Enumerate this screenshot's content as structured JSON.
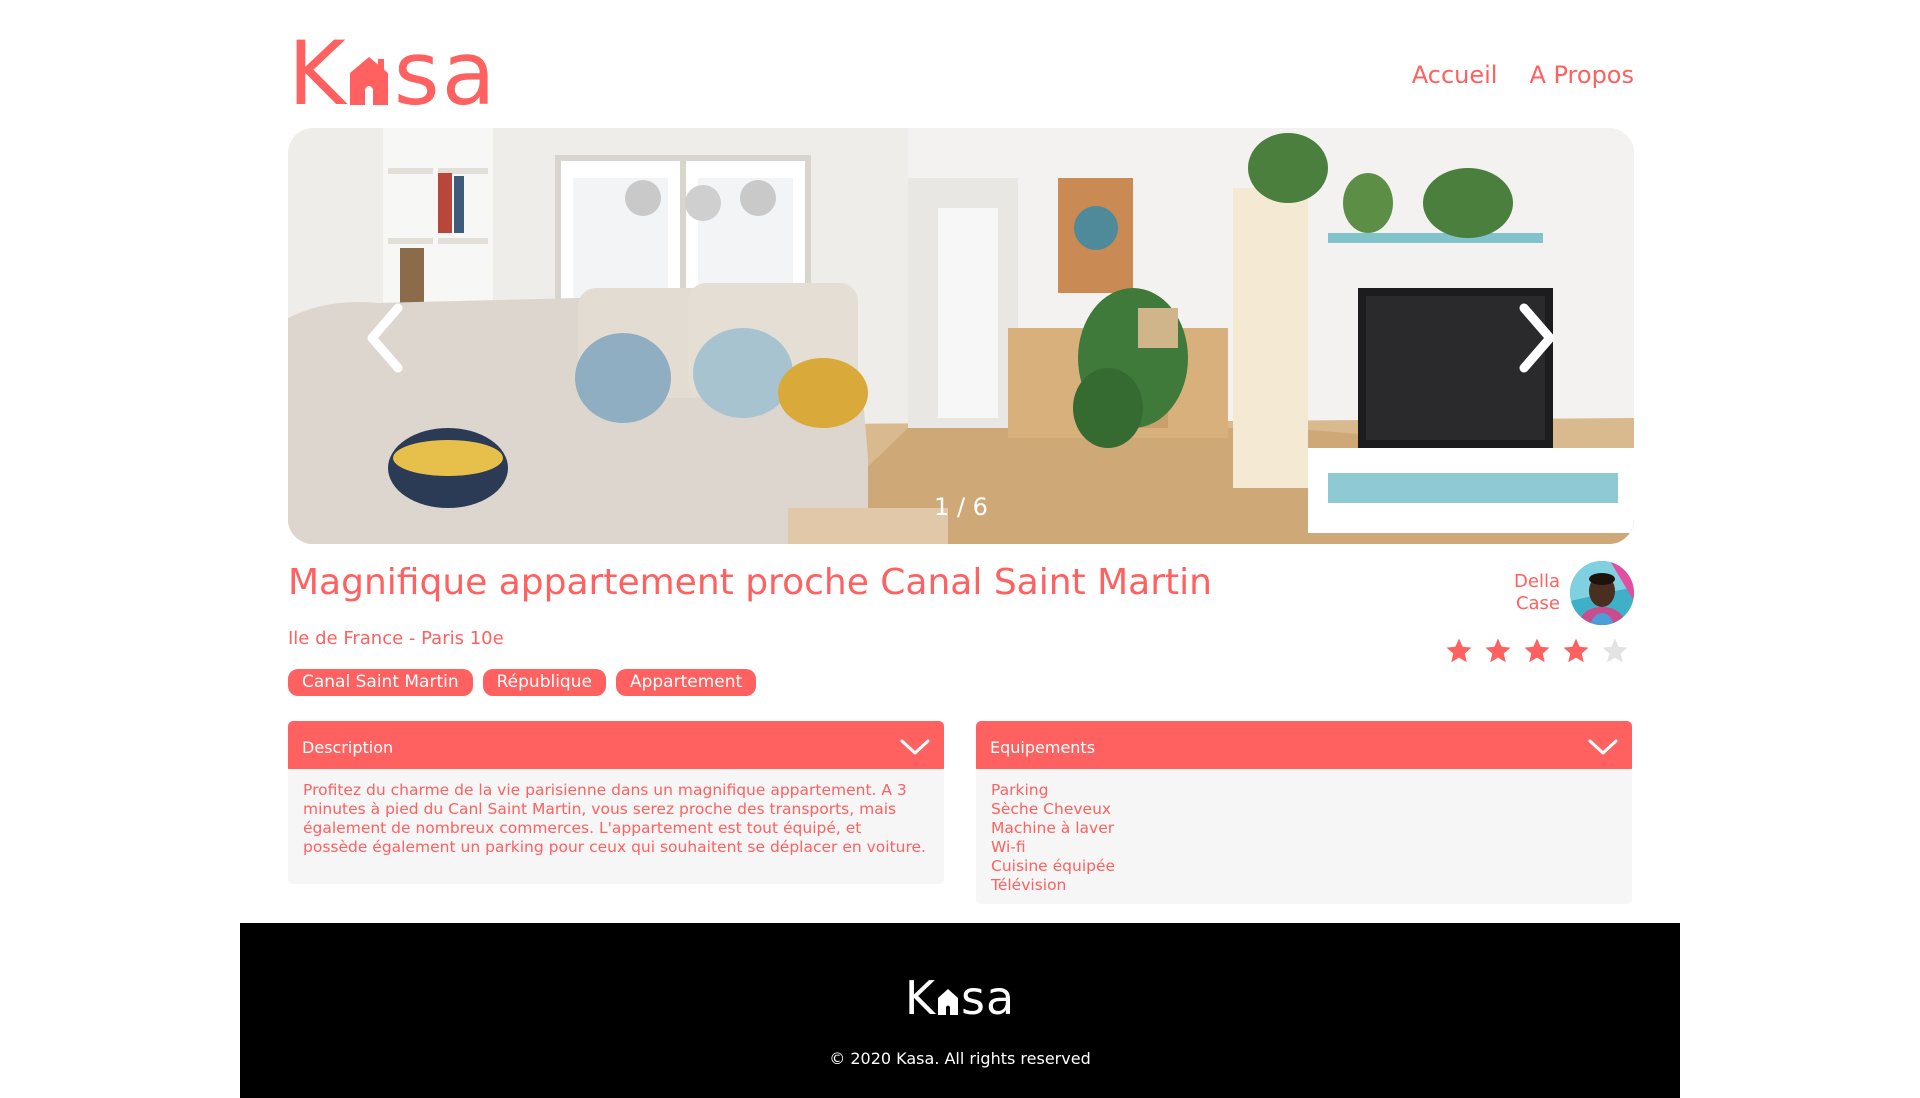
{
  "colors": {
    "accent": "#FF6060",
    "panel_bg": "#F6F6F6",
    "footer_bg": "#000000",
    "star_off": "#E3E3E3"
  },
  "header": {
    "logo": {
      "k": "K",
      "sa": "sa"
    },
    "nav": [
      {
        "label": "Accueil"
      },
      {
        "label": "A Propos"
      }
    ]
  },
  "carousel": {
    "counter": "1 / 6",
    "prev_icon": "chevron-left-icon",
    "next_icon": "chevron-right-icon"
  },
  "listing": {
    "title": "Magnifique appartement proche Canal Saint Martin",
    "location": "Ile de France - Paris 10e",
    "tags": [
      "Canal Saint Martin",
      "République",
      "Appartement"
    ],
    "host": {
      "first_name": "Della",
      "last_name": "Case"
    },
    "rating": 4,
    "rating_max": 5
  },
  "description": {
    "label": "Description",
    "text": "Profitez du charme de la vie parisienne dans un magnifique appartement. A 3 minutes à pied du Canl Saint Martin, vous serez proche des transports, mais également de nombreux commerces. L'appartement est tout équipé, et possède également un parking pour ceux qui souhaitent se déplacer en voiture."
  },
  "equipments": {
    "label": "Equipements",
    "items": [
      "Parking",
      "Sèche Cheveux",
      "Machine à laver",
      "Wi-fi",
      "Cuisine équipée",
      "Télévision"
    ]
  },
  "footer": {
    "logo": {
      "k": "K",
      "sa": "sa"
    },
    "copyright": "© 2020 Kasa. All rights reserved"
  }
}
